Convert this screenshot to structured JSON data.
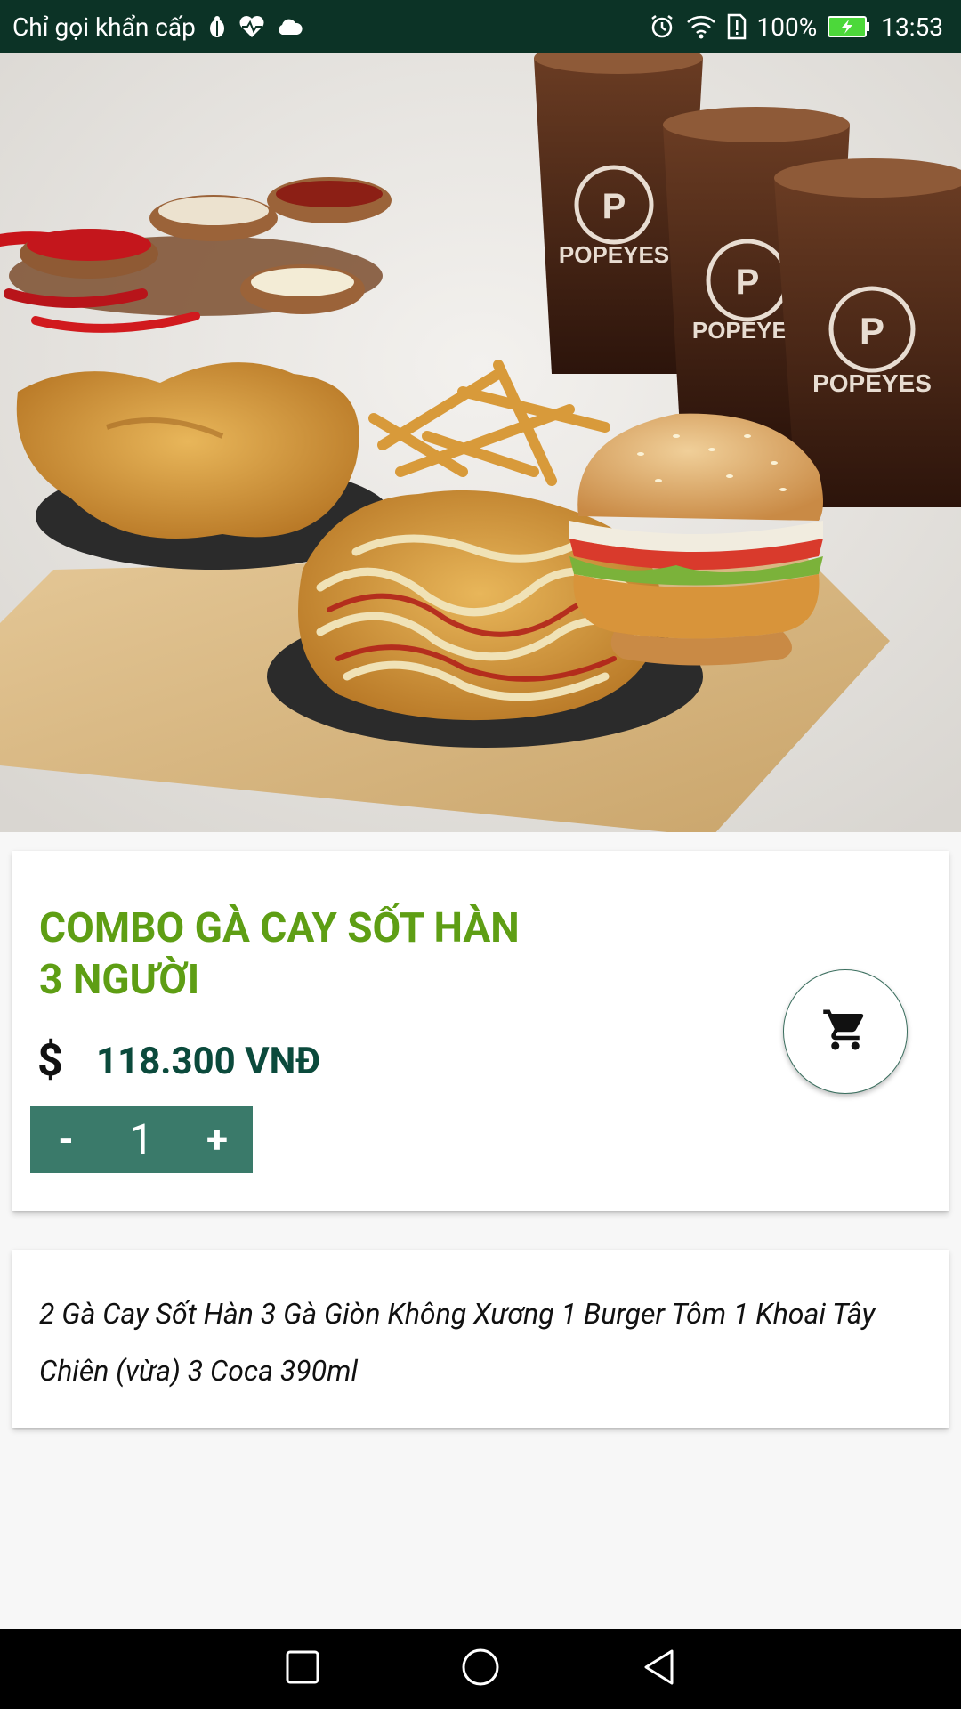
{
  "status_bar": {
    "carrier": "Chỉ gọi khẩn cấp",
    "battery": "100%",
    "time": "13:53"
  },
  "product": {
    "title": "COMBO GÀ CAY SỐT HÀN\n3 NGƯỜI",
    "currency_symbol": "$",
    "price": "118.300 VNĐ",
    "quantity": "1",
    "decrement_label": "-",
    "increment_label": "+",
    "description": "2 Gà Cay Sốt Hàn 3 Gà Giòn Không Xương 1 Burger Tôm 1 Khoai Tây Chiên (vừa) 3 Coca 390ml"
  },
  "colors": {
    "status_bar": "#0c3326",
    "title": "#5e9e14",
    "price": "#0b4a3c",
    "stepper": "#3a7a6a"
  },
  "icons": {
    "cart": "shopping-cart-icon",
    "nav_recent": "square-icon",
    "nav_home": "circle-icon",
    "nav_back": "triangle-back-icon"
  }
}
